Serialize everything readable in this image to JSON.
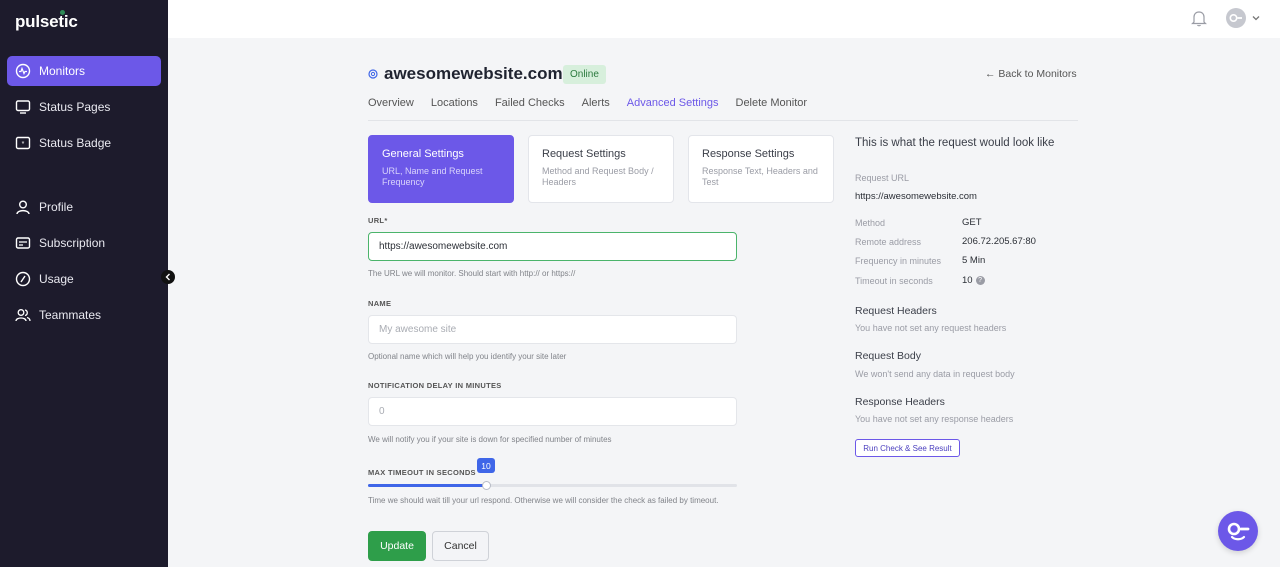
{
  "app": {
    "logo": "pulsetic"
  },
  "sidebar": {
    "items": [
      {
        "label": "Monitors",
        "icon": "pulse-icon",
        "active": true
      },
      {
        "label": "Status Pages",
        "icon": "monitor-icon"
      },
      {
        "label": "Status Badge",
        "icon": "badge-icon"
      },
      {
        "label": "Profile",
        "icon": "user-icon"
      },
      {
        "label": "Subscription",
        "icon": "card-icon"
      },
      {
        "label": "Usage",
        "icon": "gauge-icon"
      },
      {
        "label": "Teammates",
        "icon": "users-icon"
      }
    ]
  },
  "header": {
    "title": "awesomewebsite.com",
    "status": "Online",
    "back_label": "← Back to Monitors"
  },
  "tabs": [
    "Overview",
    "Locations",
    "Failed Checks",
    "Alerts",
    "Advanced Settings",
    "Delete Monitor"
  ],
  "active_tab": "Advanced Settings",
  "cards": [
    {
      "title": "General Settings",
      "sub": "URL, Name and Request Frequency"
    },
    {
      "title": "Request Settings",
      "sub": "Method and Request Body / Headers"
    },
    {
      "title": "Response Settings",
      "sub": "Response Text, Headers and Test"
    }
  ],
  "form": {
    "url_label": "URL*",
    "url_value": "https://awesomewebsite.com",
    "url_help": "The URL we will monitor. Should start with http:// or https://",
    "name_label": "NAME",
    "name_placeholder": "My awesome site",
    "name_help": "Optional name which will help you identify your site later",
    "delay_label": "NOTIFICATION DELAY IN MINUTES",
    "delay_placeholder": "0",
    "delay_help": "We will notify you if your site is down for specified number of minutes",
    "timeout_label": "MAX TIMEOUT IN SECONDS",
    "timeout_value": "10",
    "timeout_fraction": 0.32,
    "timeout_help": "Time we should wait till your url respond. Otherwise we will consider the check as failed by timeout.",
    "update_label": "Update",
    "cancel_label": "Cancel"
  },
  "preview": {
    "title": "This is what the request would look like",
    "request_url_key": "Request URL",
    "request_url_value": "https://awesomewebsite.com",
    "method_key": "Method",
    "method_value": "GET",
    "remote_key": "Remote address",
    "remote_value": "206.72.205.67:80",
    "freq_key": "Frequency in minutes",
    "freq_value": "5 Min",
    "timeout_key": "Timeout in seconds",
    "timeout_value": "10",
    "req_headers_title": "Request Headers",
    "req_headers_sub": "You have not set any request headers",
    "req_body_title": "Request Body",
    "req_body_sub": "We won't send any data in request body",
    "resp_headers_title": "Response Headers",
    "resp_headers_sub": "You have not set any response headers",
    "run_label": "Run Check & See Result"
  },
  "colors": {
    "accent": "#6c58e8",
    "sidebar": "#1d1b2c",
    "success": "#2e9e4a",
    "slider": "#3f66e8"
  }
}
